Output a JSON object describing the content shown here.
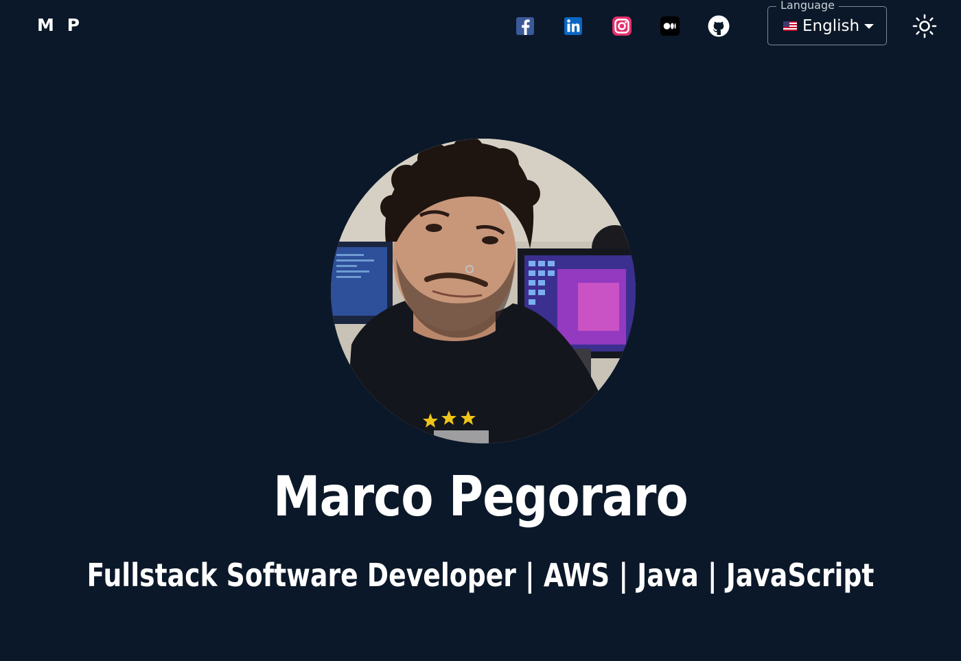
{
  "header": {
    "logo": "M P",
    "social_links": [
      {
        "name": "facebook",
        "icon": "facebook-icon",
        "color": "#3b5998"
      },
      {
        "name": "linkedin",
        "icon": "linkedin-icon",
        "color": "#0a66c2"
      },
      {
        "name": "instagram",
        "icon": "instagram-icon",
        "color": "#e1306c"
      },
      {
        "name": "medium",
        "icon": "medium-icon",
        "color": "#000000"
      },
      {
        "name": "github",
        "icon": "github-icon",
        "color": "#ffffff"
      }
    ],
    "language": {
      "label": "Language",
      "selected": "English",
      "flag": "us-flag-icon"
    },
    "theme_toggle_icon": "sun-icon"
  },
  "hero": {
    "avatar_icon": "profile-photo",
    "name": "Marco Pegoraro",
    "subtitle": "Fullstack Software Developer | AWS | Java | JavaScript"
  },
  "colors": {
    "background": "#0b1829",
    "text": "#ffffff"
  }
}
